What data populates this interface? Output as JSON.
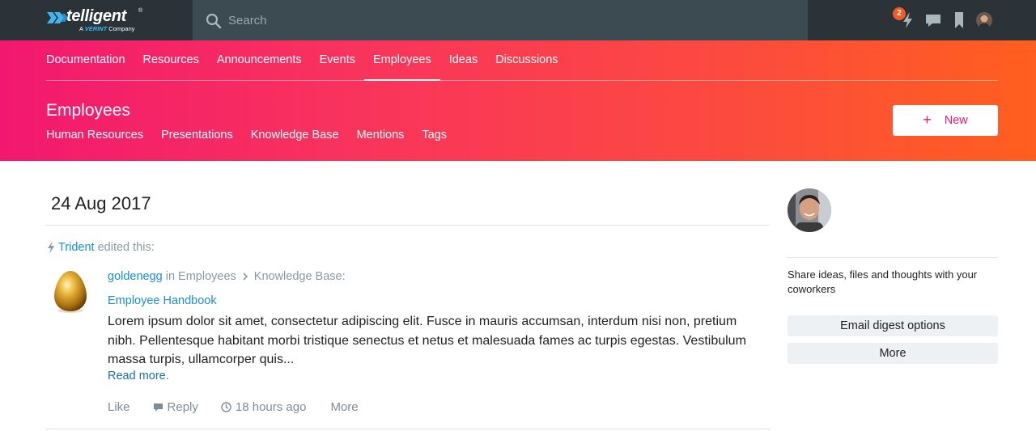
{
  "brand": {
    "name": "telligent",
    "trademark": "®",
    "tagline_prefix": "A",
    "tagline_brand": "VERINT",
    "tagline_suffix": "Company"
  },
  "search": {
    "placeholder": "Search"
  },
  "topbar": {
    "notifications_count": "2"
  },
  "nav": {
    "items": [
      "Documentation",
      "Resources",
      "Announcements",
      "Events",
      "Employees",
      "Ideas",
      "Discussions"
    ],
    "active": "Employees"
  },
  "page": {
    "title": "Employees",
    "subnav": [
      "Human Resources",
      "Presentations",
      "Knowledge Base",
      "Mentions",
      "Tags"
    ],
    "new_button": {
      "icon": "+",
      "label": "New"
    }
  },
  "feed": {
    "date": "24 Aug 2017",
    "activity": {
      "user": "Trident",
      "action": "edited this:"
    },
    "post": {
      "author": "goldenegg",
      "in_text": "in",
      "group": "Employees",
      "section": "Knowledge Base:",
      "title": "Employee Handbook",
      "excerpt": "Lorem ipsum dolor sit amet, consectetur adipiscing elit. Fusce in mauris accumsan, interdum nisi non, pretium nibh. Pellentesque habitant morbi tristique senectus et netus et malesuada fames ac turpis egestas. Vestibulum massa turpis, ullamcorper quis...",
      "read_more": "Read more.",
      "actions": {
        "like": "Like",
        "reply": "Reply",
        "time": "18 hours ago",
        "more": "More"
      }
    }
  },
  "sidebar": {
    "description": "Share ideas, files and thoughts with your coworkers",
    "buttons": [
      "Email digest options",
      "More"
    ]
  },
  "colors": {
    "topbar": "#2b3339",
    "search_bg": "#3c4a52",
    "gradient_start": "#f2186f",
    "gradient_end": "#ff5f1f",
    "link": "#1a8fd6",
    "badge": "#f35a24"
  }
}
